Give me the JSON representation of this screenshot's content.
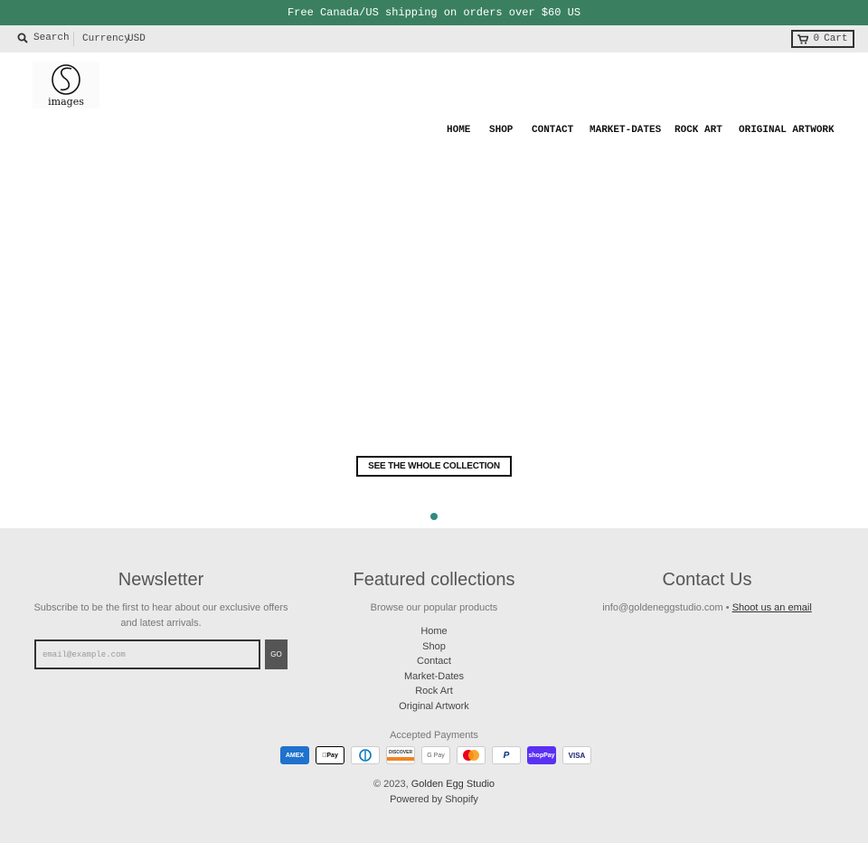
{
  "announcement": "Free Canada/US shipping on orders over $60 US",
  "topbar": {
    "search_label": "Search",
    "currency_label": "Currency",
    "currency_value": "USD",
    "cart_count": "0",
    "cart_label": "Cart"
  },
  "logo": {
    "text": "images"
  },
  "nav": {
    "home": "HOME",
    "shop": "SHOP",
    "contact": "CONTACT",
    "market": "MARKET-DATES",
    "rock": "ROCK ART",
    "original": "ORIGINAL ARTWORK"
  },
  "hero": {
    "cta": "SEE THE WHOLE COLLECTION"
  },
  "footer": {
    "newsletter": {
      "title": "Newsletter",
      "text": "Subscribe to be the first to hear about our exclusive offers and latest arrivals.",
      "placeholder": "email@example.com",
      "button": "GO"
    },
    "featured": {
      "title": "Featured collections",
      "subtitle": "Browse our popular products",
      "links": [
        "Home",
        "Shop",
        "Contact",
        "Market-Dates",
        "Rock Art",
        "Original Artwork"
      ]
    },
    "contact": {
      "title": "Contact Us",
      "email": "info@goldeneggstudio.com",
      "separator": "•",
      "link": "Shoot us an email"
    },
    "payments_label": "Accepted Payments",
    "payments": [
      "AMEX",
      "Pay",
      "DC",
      "DISCOVER",
      "G Pay",
      "MC",
      "P",
      "Pay",
      "VISA"
    ],
    "copyright_prefix": "© 2023,",
    "store_name": "Golden Egg Studio",
    "powered": "Powered by Shopify"
  },
  "colors": {
    "brand_green": "#3a8060",
    "dot": "#2f8a80"
  }
}
